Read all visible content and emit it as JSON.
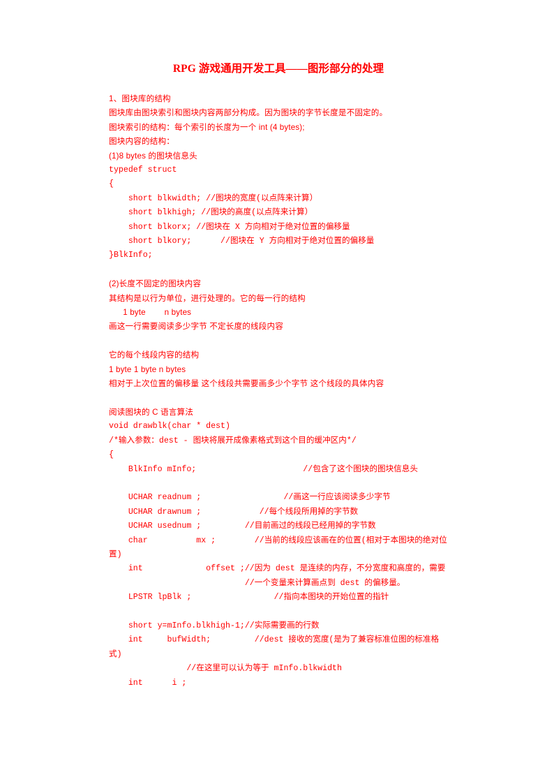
{
  "document": {
    "title": "RPG 游戏通用开发工具——图形部分的处理",
    "text_color": "#ff0000",
    "background_color": "#ffffff",
    "sections": [
      {
        "name": "section-1-heading",
        "kind": "prose",
        "lines": [
          "1、图块库的结构",
          "图块库由图块索引和图块内容两部分构成。因为图块的字节长度是不固定的。",
          "图块索引的结构：每个索引的长度为一个   int (4 bytes);",
          "图块内容的结构：",
          "(1)8 bytes 的图块信息头"
        ]
      },
      {
        "name": "blkinfo-struct-code",
        "kind": "code",
        "lines": [
          "typedef struct",
          "{",
          "    short blkwidth; //图块的宽度(以点阵来计算）",
          "    short blkhigh; //图块的高度(以点阵来计算）",
          "    short blkorx; //图块在 X 方向相对于绝对位置的偏移量",
          "    short blkory;      //图块在 Y 方向相对于绝对位置的偏移量",
          "}BlkInfo;"
        ]
      },
      {
        "name": "spacer-1",
        "kind": "blank",
        "lines": [
          ""
        ]
      },
      {
        "name": "section-2-variable-length-content",
        "kind": "prose",
        "lines": [
          "(2)长度不固定的图块内容",
          "其结构是以行为单位，进行处理的。它的每一行的结构"
        ]
      },
      {
        "name": "row-structure-byte-labels",
        "kind": "prose-indent",
        "lines": [
          "      1 byte        n bytes"
        ]
      },
      {
        "name": "row-structure-description",
        "kind": "prose",
        "lines": [
          "画这一行需要阅读多少字节   不定长度的线段内容"
        ]
      },
      {
        "name": "spacer-2",
        "kind": "blank",
        "lines": [
          ""
        ]
      },
      {
        "name": "segment-structure-heading",
        "kind": "prose",
        "lines": [
          "它的每个线段内容的结构",
          "1 byte 1 byte n bytes",
          "相对于上次位置的偏移量   这个线段共需要画多少个字节   这个线段的具体内容"
        ]
      },
      {
        "name": "spacer-3",
        "kind": "blank",
        "lines": [
          ""
        ]
      },
      {
        "name": "c-algorithm-heading",
        "kind": "prose",
        "lines": [
          "阅读图块的 C 语言算法"
        ]
      },
      {
        "name": "drawblk-function-code",
        "kind": "code",
        "lines": [
          "void drawblk(char * dest)",
          "/*输入参数：dest - 图块将展开成像素格式到这个目的缓冲区内*/",
          "{",
          "    BlkInfo mInfo;                      //包含了这个图块的图块信息头",
          "",
          "    UCHAR readnum ;                 //画这一行应该阅读多少字节",
          "    UCHAR drawnum ;            //每个线段所用掉的字节数",
          "    UCHAR usednum ;         //目前画过的线段已经用掉的字节数",
          "    char          mx ;        //当前的线段应该画在的位置(相对于本图块的绝对位置)",
          "    int             offset ;//因为 dest 是连续的内存，不分宽度和高度的，需要",
          "                            //一个变量来计算画点到 dest 的偏移量。",
          "    LPSTR lpBlk ;                 //指向本图块的开始位置的指针",
          "",
          "    short y=mInfo.blkhigh-1;//实际需要画的行数",
          "    int     bufWidth;         //dest 接收的宽度(是为了兼容标准位图的标准格式)",
          "                //在这里可以认为等于 mInfo.blkwidth",
          "    int      i ;"
        ]
      }
    ]
  }
}
